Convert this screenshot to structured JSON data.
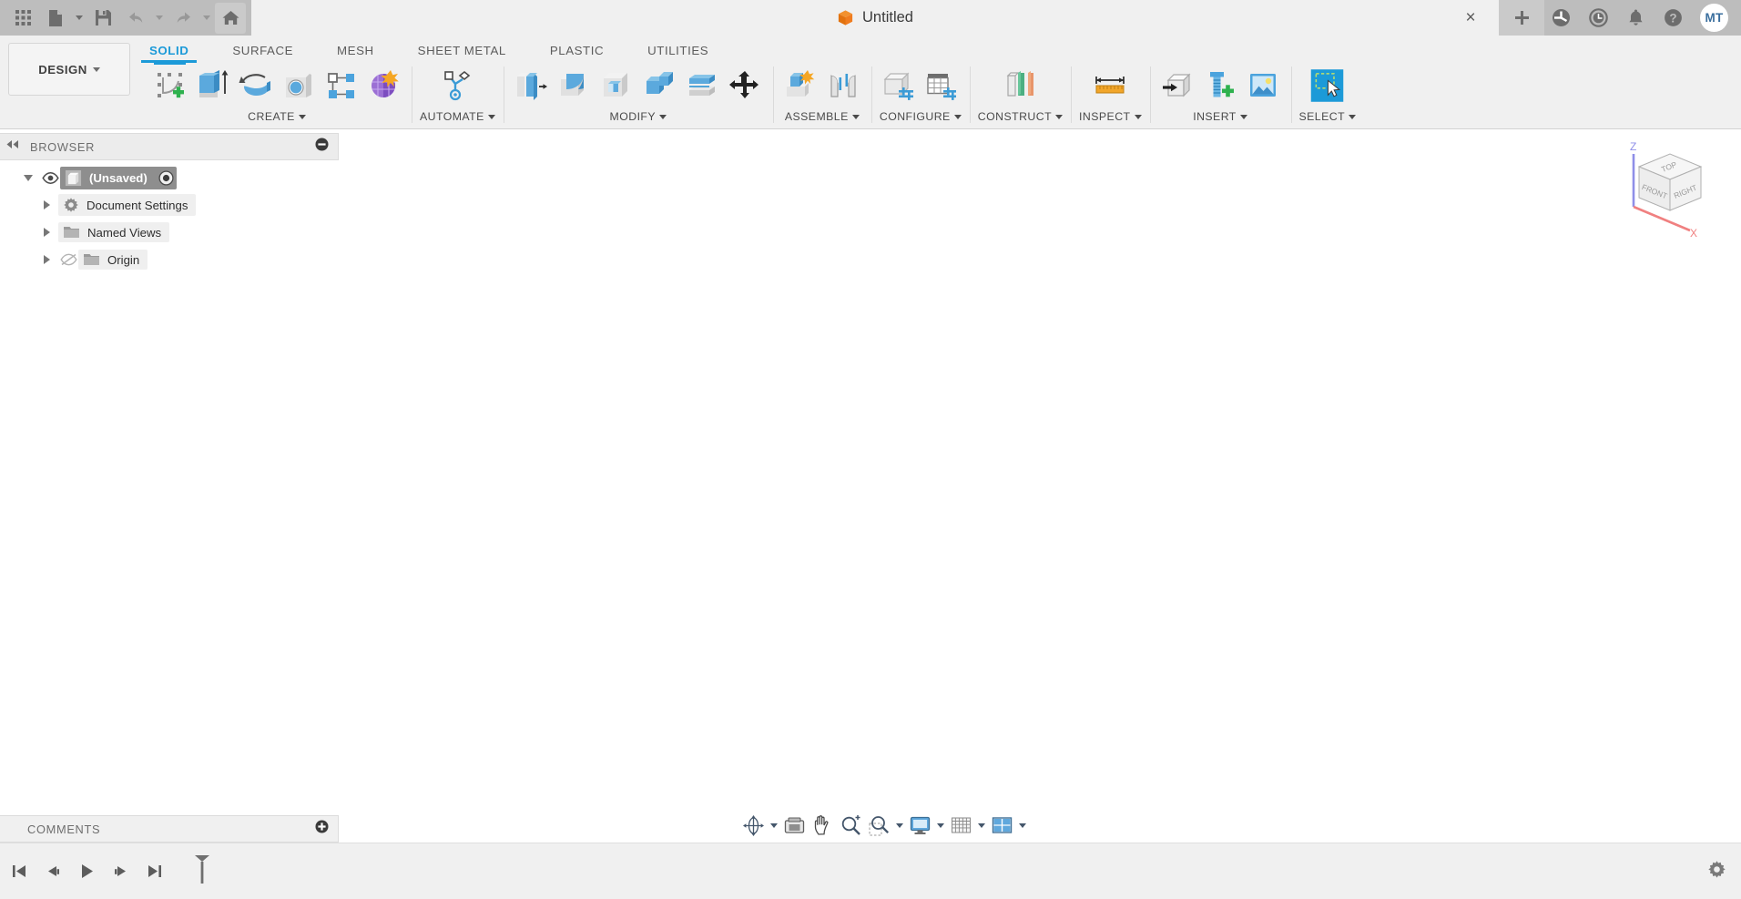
{
  "titlebar": {
    "grid_icon": "app-grid-icon",
    "new_label": "new-document-icon",
    "save_label": "save-icon",
    "undo_label": "undo-icon",
    "redo_label": "redo-icon",
    "home_label": "home-icon",
    "document_title": "Untitled",
    "close_glyph": "×",
    "new_tab_glyph": "+",
    "right_icons": [
      "extension-icon",
      "job-status-clock-icon",
      "notifications-bell-icon",
      "help-icon"
    ],
    "avatar_initials": "MT"
  },
  "ribbon": {
    "design_label": "DESIGN",
    "tabs": [
      {
        "label": "SOLID",
        "selected": true
      },
      {
        "label": "SURFACE",
        "selected": false
      },
      {
        "label": "MESH",
        "selected": false
      },
      {
        "label": "SHEET METAL",
        "selected": false
      },
      {
        "label": "PLASTIC",
        "selected": false
      },
      {
        "label": "UTILITIES",
        "selected": false
      }
    ],
    "groups": [
      {
        "label": "CREATE",
        "dropdown": true,
        "icons": [
          "create-sketch-icon",
          "extrude-icon",
          "revolve-icon",
          "cylinder-icon",
          "pattern-icon",
          "create-form-icon"
        ]
      },
      {
        "label": "AUTOMATE",
        "dropdown": true,
        "icons": [
          "automate-icon"
        ]
      },
      {
        "label": "MODIFY",
        "dropdown": true,
        "icons": [
          "press-pull-icon",
          "fillet-icon",
          "shell-icon",
          "combine-icon",
          "offset-face-icon",
          "move-copy-icon"
        ]
      },
      {
        "label": "ASSEMBLE",
        "dropdown": true,
        "icons": [
          "new-component-icon",
          "joint-icon"
        ]
      },
      {
        "label": "CONFIGURE",
        "dropdown": true,
        "icons": [
          "create-configuration-icon",
          "configuration-table-icon"
        ]
      },
      {
        "label": "CONSTRUCT",
        "dropdown": true,
        "icons": [
          "offset-plane-icon"
        ]
      },
      {
        "label": "INSPECT",
        "dropdown": true,
        "icons": [
          "measure-icon"
        ]
      },
      {
        "label": "INSERT",
        "dropdown": true,
        "icons": [
          "insert-derive-icon",
          "insert-mcmaster-icon",
          "insert-canvas-icon"
        ]
      },
      {
        "label": "SELECT",
        "dropdown": true,
        "icons": [
          "select-window-icon"
        ]
      }
    ]
  },
  "browser": {
    "title": "BROWSER",
    "collapse_icon": "collapse-panel-icon",
    "minimize_icon": "minimize-icon",
    "tree": [
      {
        "label": "(Unsaved)",
        "icon": "component-icon",
        "root": true,
        "expanded": true,
        "visible": true
      },
      {
        "label": "Document Settings",
        "icon": "gear-icon",
        "root": false,
        "expanded": false
      },
      {
        "label": "Named Views",
        "icon": "folder-icon",
        "root": false,
        "expanded": false
      },
      {
        "label": "Origin",
        "icon": "folder-icon",
        "root": false,
        "expanded": false,
        "hidden_eye": true
      }
    ]
  },
  "viewcube": {
    "top_label": "TOP",
    "front_label": "FRONT",
    "right_label": "RIGHT",
    "z_label": "Z",
    "x_label": "X",
    "z_color": "#8f8fe8",
    "x_color": "#f08080"
  },
  "comments": {
    "title": "COMMENTS",
    "add_icon": "add-comment-icon"
  },
  "navbar": {
    "items": [
      {
        "name": "orbit-icon",
        "dropdown": true
      },
      {
        "name": "look-at-icon",
        "dropdown": false
      },
      {
        "name": "pan-icon",
        "dropdown": false
      },
      {
        "name": "zoom-icon",
        "dropdown": false
      },
      {
        "name": "zoom-window-icon",
        "dropdown": true
      },
      {
        "name": "display-settings-icon",
        "dropdown": true
      },
      {
        "name": "grid-snaps-icon",
        "dropdown": true
      },
      {
        "name": "viewports-icon",
        "dropdown": true
      }
    ]
  },
  "timeline": {
    "controls": [
      "skip-to-beginning-icon",
      "step-backward-icon",
      "play-icon",
      "step-forward-icon",
      "skip-to-end-icon"
    ],
    "marker": "timeline-marker",
    "settings_icon": "timeline-settings-gear-icon"
  },
  "colors": {
    "accent_blue": "#1c9ad8",
    "titlebar_gray": "#bdbdbd",
    "ribbon_gray": "#f0f0f0",
    "canvas_white": "#ffffff",
    "cube_orange": "#f07c1e"
  }
}
